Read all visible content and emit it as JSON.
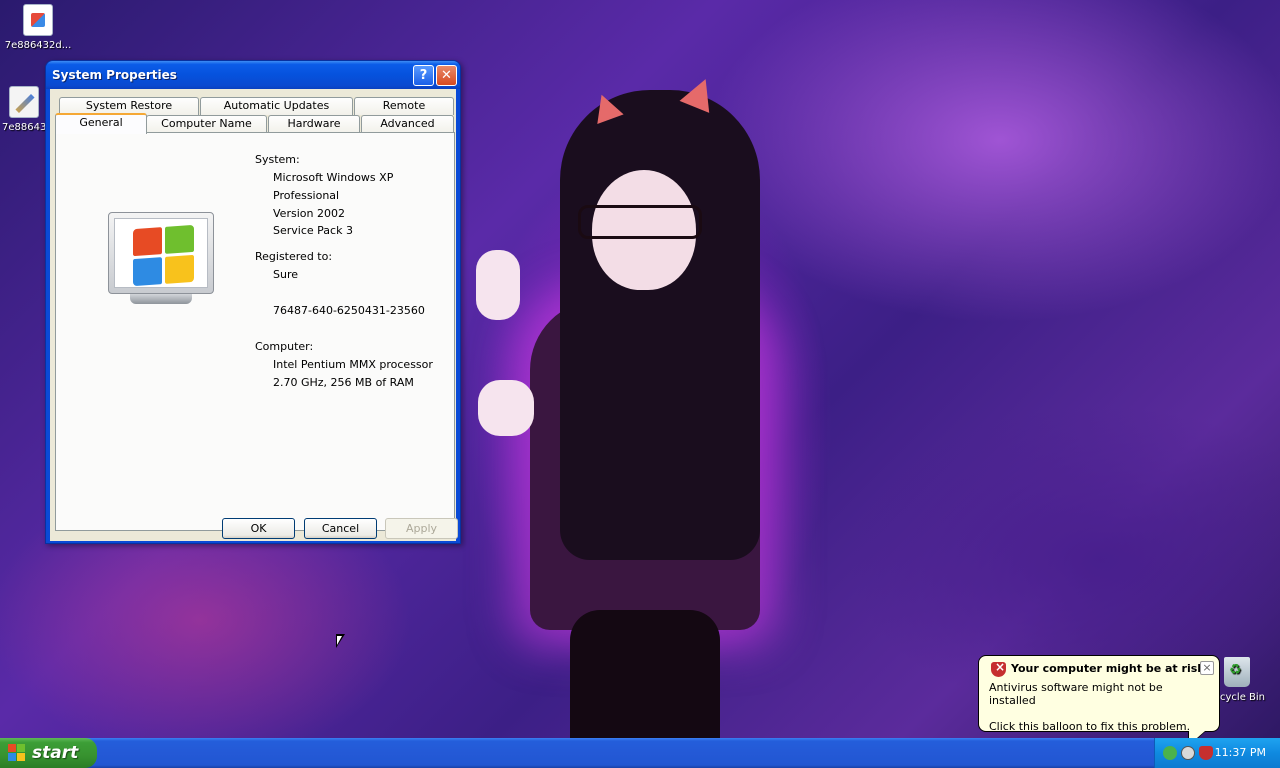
{
  "desktop": {
    "icons": [
      {
        "label": "7e886432d..."
      },
      {
        "label": "7e88643"
      }
    ],
    "recycle_bin": {
      "label": "cycle Bin"
    }
  },
  "window": {
    "title": "System Properties",
    "tabs_row1": [
      "System Restore",
      "Automatic Updates",
      "Remote"
    ],
    "tabs_row2": [
      "General",
      "Computer Name",
      "Hardware",
      "Advanced"
    ],
    "active_tab": "General",
    "general": {
      "system_heading": "System:",
      "system_lines": [
        "Microsoft Windows XP",
        "Professional",
        "Version 2002",
        "Service Pack 3"
      ],
      "registered_heading": "Registered to:",
      "registered_name": "Sure",
      "product_id": "76487-640-6250431-23560",
      "computer_heading": "Computer:",
      "computer_lines": [
        "Intel Pentium MMX processor",
        "2.70 GHz, 256 MB of RAM"
      ]
    },
    "buttons": {
      "ok": "OK",
      "cancel": "Cancel",
      "apply": "Apply"
    }
  },
  "taskbar": {
    "start_label": "start",
    "clock": "11:37 PM"
  },
  "balloon": {
    "title": "Your computer might be at risk",
    "line1": "Antivirus software might not be installed",
    "line2": "Click this balloon to fix this problem.",
    "close_glyph": "×"
  },
  "colors": {
    "xp_blue": "#0a4ad6",
    "start_green": "#37922f",
    "balloon_bg": "#ffffe1",
    "tray_blue": "#0f8ae0"
  }
}
